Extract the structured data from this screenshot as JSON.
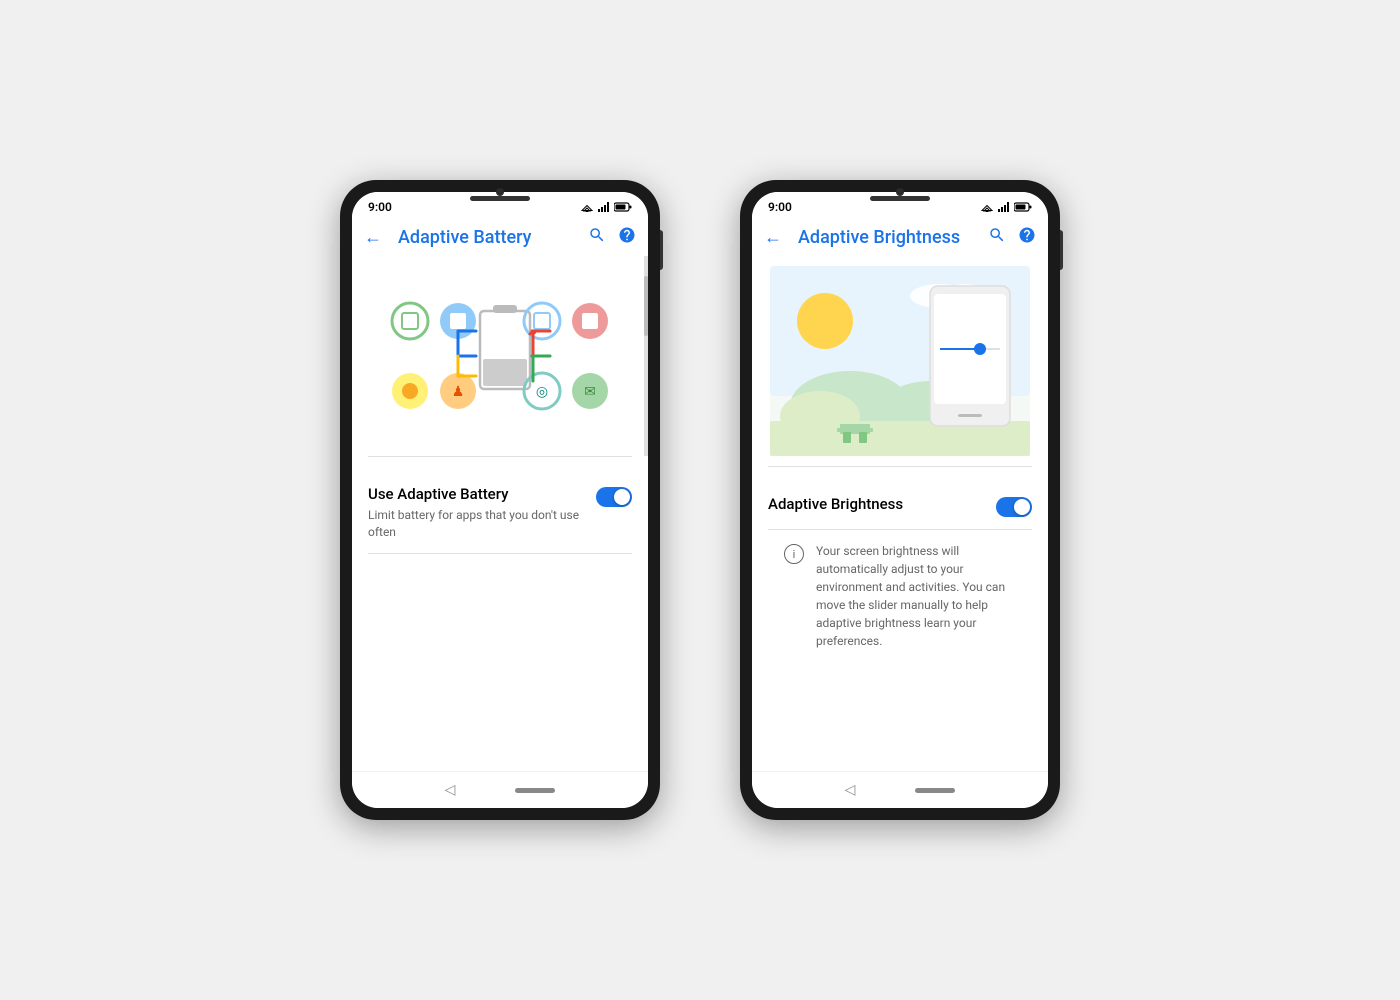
{
  "page": {
    "background": "#f0f0f0"
  },
  "phone1": {
    "status_time": "9:00",
    "app_bar_title": "Adaptive Battery",
    "back_label": "←",
    "search_icon": "search",
    "help_icon": "help",
    "setting": {
      "title": "Use Adaptive Battery",
      "description": "Limit battery for apps that you don't use often",
      "toggle_state": "on"
    },
    "nav": {
      "back": "◁"
    }
  },
  "phone2": {
    "status_time": "9:00",
    "app_bar_title": "Adaptive Brightness",
    "back_label": "←",
    "search_icon": "search",
    "help_icon": "help",
    "setting": {
      "title": "Adaptive Brightness",
      "toggle_state": "on"
    },
    "info_text": "Your screen brightness will automatically adjust to your environment and activities. You can move the slider manually to help adaptive brightness learn your preferences.",
    "nav": {
      "back": "◁"
    }
  }
}
